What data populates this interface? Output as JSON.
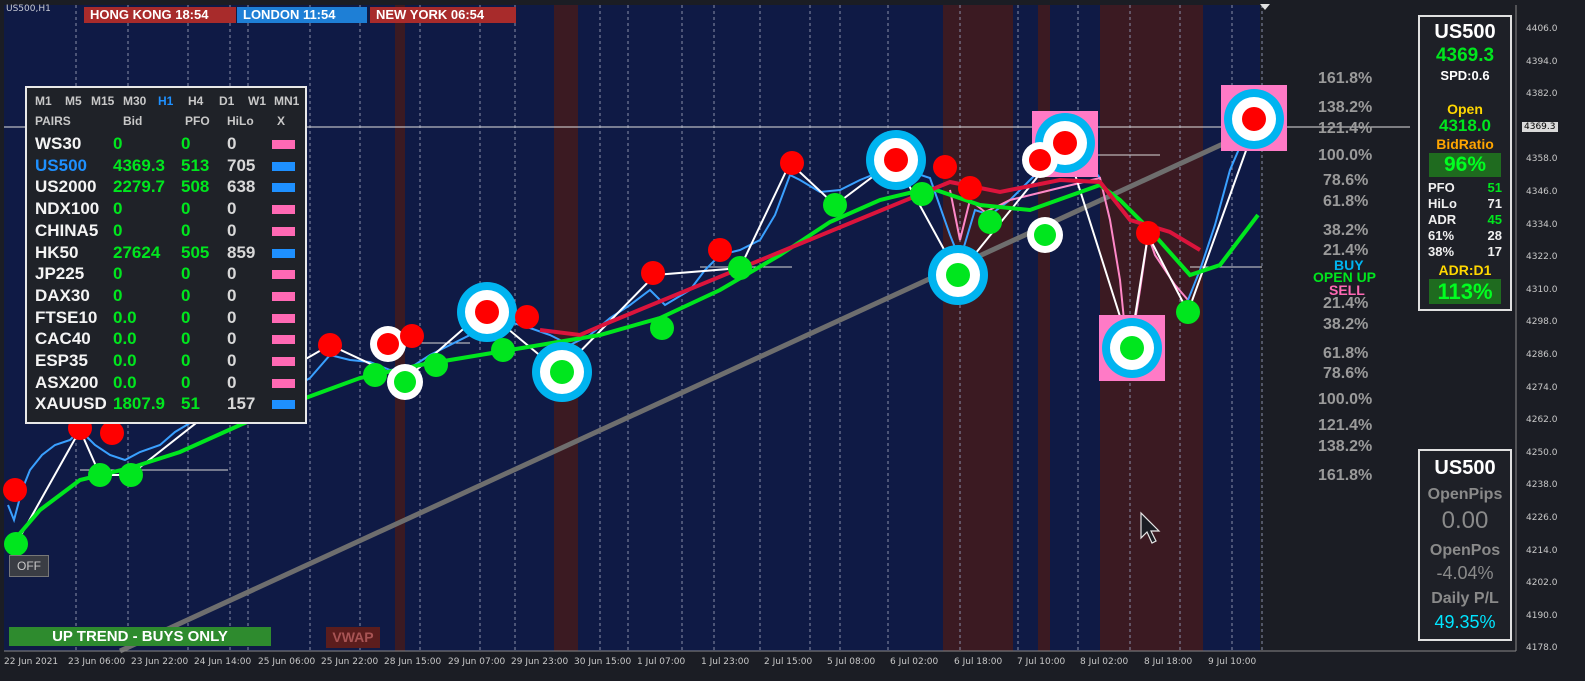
{
  "symbol_label": "US500,H1",
  "clocks": [
    {
      "label": "HONG KONG 18:54",
      "color": "#a82b2b"
    },
    {
      "label": "LONDON  11:54",
      "color": "#1e7fd6"
    },
    {
      "label": "NEW YORK 06:54",
      "color": "#a82b2b"
    }
  ],
  "timeframes": [
    "M1",
    "M5",
    "M15",
    "M30",
    "H1",
    "H4",
    "D1",
    "W1",
    "MN1"
  ],
  "active_timeframe": "H1",
  "pairs_table": {
    "headers": [
      "PAIRS",
      "Bid",
      "PFO",
      "HiLo",
      "X"
    ],
    "rows": [
      {
        "symbol": "WS30",
        "bid": "0",
        "pfo": "0",
        "hilo": "0",
        "x_color": "#ff69b4"
      },
      {
        "symbol": "US500",
        "bid": "4369.3",
        "pfo": "513",
        "hilo": "705",
        "x_color": "#1e90ff",
        "highlight": true
      },
      {
        "symbol": "US2000",
        "bid": "2279.7",
        "pfo": "508",
        "hilo": "638",
        "x_color": "#1e90ff"
      },
      {
        "symbol": "NDX100",
        "bid": "0",
        "pfo": "0",
        "hilo": "0",
        "x_color": "#ff69b4"
      },
      {
        "symbol": "CHINA5",
        "bid": "0",
        "pfo": "0",
        "hilo": "0",
        "x_color": "#ff69b4"
      },
      {
        "symbol": "HK50",
        "bid": "27624",
        "pfo": "505",
        "hilo": "859",
        "x_color": "#1e90ff"
      },
      {
        "symbol": "JP225",
        "bid": "0",
        "pfo": "0",
        "hilo": "0",
        "x_color": "#ff69b4"
      },
      {
        "symbol": "DAX30",
        "bid": "0",
        "pfo": "0",
        "hilo": "0",
        "x_color": "#ff69b4"
      },
      {
        "symbol": "FTSE10",
        "bid": "0.0",
        "pfo": "0",
        "hilo": "0",
        "x_color": "#ff69b4"
      },
      {
        "symbol": "CAC40",
        "bid": "0.0",
        "pfo": "0",
        "hilo": "0",
        "x_color": "#ff69b4"
      },
      {
        "symbol": "ESP35",
        "bid": "0.0",
        "pfo": "0",
        "hilo": "0",
        "x_color": "#ff69b4"
      },
      {
        "symbol": "ASX200",
        "bid": "0.0",
        "pfo": "0",
        "hilo": "0",
        "x_color": "#ff69b4"
      },
      {
        "symbol": "XAUUSD",
        "bid": "1807.9",
        "pfo": "51",
        "hilo": "157",
        "x_color": "#1e90ff"
      }
    ]
  },
  "off_button": "OFF",
  "trend_banner": "UP TREND - BUYS ONLY",
  "vwap_button": "VWAP",
  "fib_upper": [
    "161.8%",
    "138.2%",
    "121.4%",
    "100.0%",
    "78.6%",
    "61.8%",
    "38.2%",
    "21.4%"
  ],
  "signals": {
    "buy": "BUY",
    "open": "OPEN UP",
    "sell": "SELL"
  },
  "fib_lower": [
    "21.4%",
    "38.2%",
    "61.8%",
    "78.6%",
    "100.0%",
    "121.4%",
    "138.2%",
    "161.8%"
  ],
  "price_axis": [
    "4406.0",
    "4394.0",
    "4382.0",
    "4370.0",
    "4358.0",
    "4346.0",
    "4334.0",
    "4322.0",
    "4310.0",
    "4298.0",
    "4286.0",
    "4274.0",
    "4262.0",
    "4250.0",
    "4238.0",
    "4226.0",
    "4214.0",
    "4202.0",
    "4190.0",
    "4178.0"
  ],
  "current_price_tag": "4369.3",
  "time_axis": [
    "22 Jun 2021",
    "23 Jun 06:00",
    "23 Jun 22:00",
    "24 Jun 14:00",
    "25 Jun 06:00",
    "25 Jun 22:00",
    "28 Jun 15:00",
    "29 Jun 07:00",
    "29 Jun 23:00",
    "30 Jun 15:00",
    "1 Jul 07:00",
    "1 Jul 23:00",
    "2 Jul 15:00",
    "5 Jul 08:00",
    "6 Jul 02:00",
    "6 Jul 18:00",
    "7 Jul 10:00",
    "8 Jul 02:00",
    "8 Jul 18:00",
    "9 Jul 10:00"
  ],
  "info_panel": {
    "symbol": "US500",
    "price": "4369.3",
    "spread": "SPD:0.6",
    "open_label": "Open",
    "open_value": "4318.0",
    "bidratio_label": "BidRatio",
    "bidratio_value": "96%",
    "stats": [
      {
        "label": "PFO",
        "value": "51"
      },
      {
        "label": "HiLo",
        "value": "71"
      },
      {
        "label": "ADR",
        "value": "45"
      },
      {
        "label": "61%",
        "value": "28"
      },
      {
        "label": "38%",
        "value": "17"
      }
    ],
    "adr_label": "ADR:D1",
    "adr_value": "113%"
  },
  "pnl_panel": {
    "symbol": "US500",
    "open_pips_label": "OpenPips",
    "open_pips_value": "0.00",
    "open_pos_label": "OpenPos",
    "open_pos_value": "-4.04%",
    "daily_label": "Daily P/L",
    "daily_value": "49.35%"
  },
  "colors": {
    "background": "#0f1a45",
    "session": "#3b1a22",
    "bull": "#00e61e",
    "bear": "#ff0000",
    "ring": "#00b4f0",
    "pink": "#ff69b4"
  }
}
